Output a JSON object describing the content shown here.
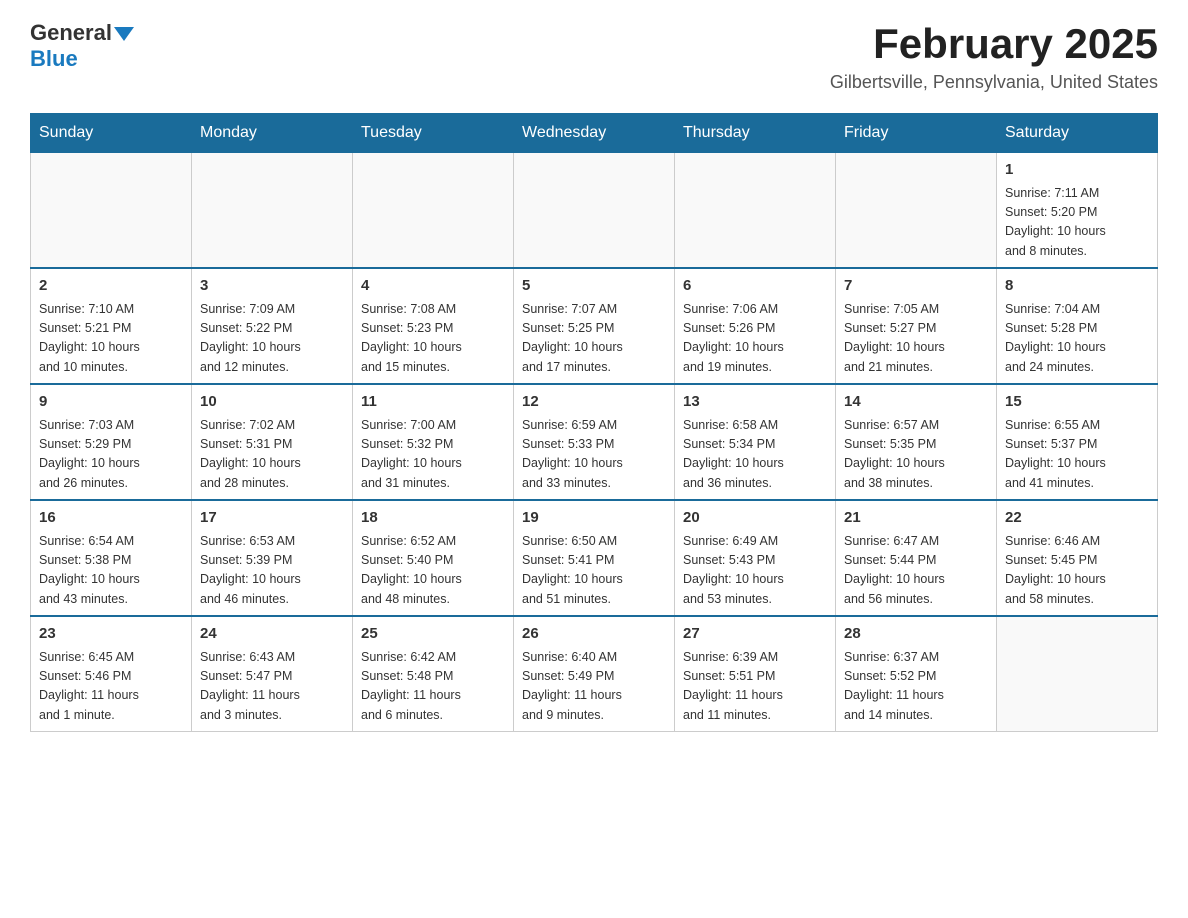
{
  "header": {
    "logo_general": "General",
    "logo_blue": "Blue",
    "title": "February 2025",
    "location": "Gilbertsville, Pennsylvania, United States"
  },
  "days_of_week": [
    "Sunday",
    "Monday",
    "Tuesday",
    "Wednesday",
    "Thursday",
    "Friday",
    "Saturday"
  ],
  "weeks": [
    [
      {
        "day": "",
        "info": ""
      },
      {
        "day": "",
        "info": ""
      },
      {
        "day": "",
        "info": ""
      },
      {
        "day": "",
        "info": ""
      },
      {
        "day": "",
        "info": ""
      },
      {
        "day": "",
        "info": ""
      },
      {
        "day": "1",
        "info": "Sunrise: 7:11 AM\nSunset: 5:20 PM\nDaylight: 10 hours\nand 8 minutes."
      }
    ],
    [
      {
        "day": "2",
        "info": "Sunrise: 7:10 AM\nSunset: 5:21 PM\nDaylight: 10 hours\nand 10 minutes."
      },
      {
        "day": "3",
        "info": "Sunrise: 7:09 AM\nSunset: 5:22 PM\nDaylight: 10 hours\nand 12 minutes."
      },
      {
        "day": "4",
        "info": "Sunrise: 7:08 AM\nSunset: 5:23 PM\nDaylight: 10 hours\nand 15 minutes."
      },
      {
        "day": "5",
        "info": "Sunrise: 7:07 AM\nSunset: 5:25 PM\nDaylight: 10 hours\nand 17 minutes."
      },
      {
        "day": "6",
        "info": "Sunrise: 7:06 AM\nSunset: 5:26 PM\nDaylight: 10 hours\nand 19 minutes."
      },
      {
        "day": "7",
        "info": "Sunrise: 7:05 AM\nSunset: 5:27 PM\nDaylight: 10 hours\nand 21 minutes."
      },
      {
        "day": "8",
        "info": "Sunrise: 7:04 AM\nSunset: 5:28 PM\nDaylight: 10 hours\nand 24 minutes."
      }
    ],
    [
      {
        "day": "9",
        "info": "Sunrise: 7:03 AM\nSunset: 5:29 PM\nDaylight: 10 hours\nand 26 minutes."
      },
      {
        "day": "10",
        "info": "Sunrise: 7:02 AM\nSunset: 5:31 PM\nDaylight: 10 hours\nand 28 minutes."
      },
      {
        "day": "11",
        "info": "Sunrise: 7:00 AM\nSunset: 5:32 PM\nDaylight: 10 hours\nand 31 minutes."
      },
      {
        "day": "12",
        "info": "Sunrise: 6:59 AM\nSunset: 5:33 PM\nDaylight: 10 hours\nand 33 minutes."
      },
      {
        "day": "13",
        "info": "Sunrise: 6:58 AM\nSunset: 5:34 PM\nDaylight: 10 hours\nand 36 minutes."
      },
      {
        "day": "14",
        "info": "Sunrise: 6:57 AM\nSunset: 5:35 PM\nDaylight: 10 hours\nand 38 minutes."
      },
      {
        "day": "15",
        "info": "Sunrise: 6:55 AM\nSunset: 5:37 PM\nDaylight: 10 hours\nand 41 minutes."
      }
    ],
    [
      {
        "day": "16",
        "info": "Sunrise: 6:54 AM\nSunset: 5:38 PM\nDaylight: 10 hours\nand 43 minutes."
      },
      {
        "day": "17",
        "info": "Sunrise: 6:53 AM\nSunset: 5:39 PM\nDaylight: 10 hours\nand 46 minutes."
      },
      {
        "day": "18",
        "info": "Sunrise: 6:52 AM\nSunset: 5:40 PM\nDaylight: 10 hours\nand 48 minutes."
      },
      {
        "day": "19",
        "info": "Sunrise: 6:50 AM\nSunset: 5:41 PM\nDaylight: 10 hours\nand 51 minutes."
      },
      {
        "day": "20",
        "info": "Sunrise: 6:49 AM\nSunset: 5:43 PM\nDaylight: 10 hours\nand 53 minutes."
      },
      {
        "day": "21",
        "info": "Sunrise: 6:47 AM\nSunset: 5:44 PM\nDaylight: 10 hours\nand 56 minutes."
      },
      {
        "day": "22",
        "info": "Sunrise: 6:46 AM\nSunset: 5:45 PM\nDaylight: 10 hours\nand 58 minutes."
      }
    ],
    [
      {
        "day": "23",
        "info": "Sunrise: 6:45 AM\nSunset: 5:46 PM\nDaylight: 11 hours\nand 1 minute."
      },
      {
        "day": "24",
        "info": "Sunrise: 6:43 AM\nSunset: 5:47 PM\nDaylight: 11 hours\nand 3 minutes."
      },
      {
        "day": "25",
        "info": "Sunrise: 6:42 AM\nSunset: 5:48 PM\nDaylight: 11 hours\nand 6 minutes."
      },
      {
        "day": "26",
        "info": "Sunrise: 6:40 AM\nSunset: 5:49 PM\nDaylight: 11 hours\nand 9 minutes."
      },
      {
        "day": "27",
        "info": "Sunrise: 6:39 AM\nSunset: 5:51 PM\nDaylight: 11 hours\nand 11 minutes."
      },
      {
        "day": "28",
        "info": "Sunrise: 6:37 AM\nSunset: 5:52 PM\nDaylight: 11 hours\nand 14 minutes."
      },
      {
        "day": "",
        "info": ""
      }
    ]
  ]
}
